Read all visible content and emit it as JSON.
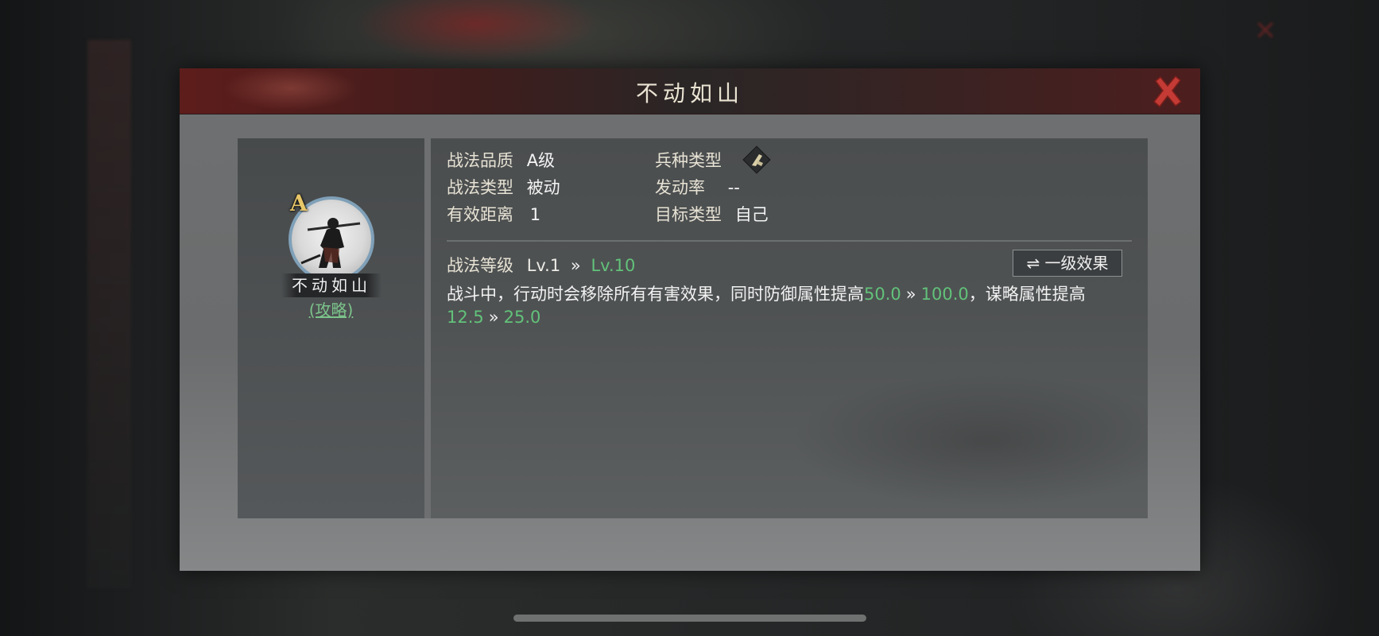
{
  "dialog": {
    "title": "不动如山",
    "close_icon": "close-x-icon"
  },
  "skill_card": {
    "grade_letter": "A",
    "name": "不动如山",
    "guide_link": "(攻略)"
  },
  "info": {
    "quality_label": "战法品质",
    "quality_value": "A级",
    "unit_type_label": "兵种类型",
    "unit_type_icon": "troop-type-icon",
    "skill_type_label": "战法类型",
    "skill_type_value": "被动",
    "trigger_rate_label": "发动率",
    "trigger_rate_value": "--",
    "range_label": "有效距离",
    "range_value": "1",
    "target_label": "目标类型",
    "target_value": "自己"
  },
  "level": {
    "label": "战法等级",
    "from": "Lv.1",
    "arrow": "»",
    "to": "Lv.10",
    "effect_button_label": "⇌ 一级效果"
  },
  "description": {
    "part1": "战斗中，行动时会移除所有有害效果，同时防御属性提高",
    "def_from": "50.0",
    "arrow": "»",
    "def_to": "100.0",
    "part2": "，谋略属性提高",
    "int_from": "12.5",
    "int_to": "25.0"
  },
  "colors": {
    "accent_green": "#62c27a",
    "title_bar_red": "#5d1d1b",
    "grade_gold": "#e8c769"
  }
}
